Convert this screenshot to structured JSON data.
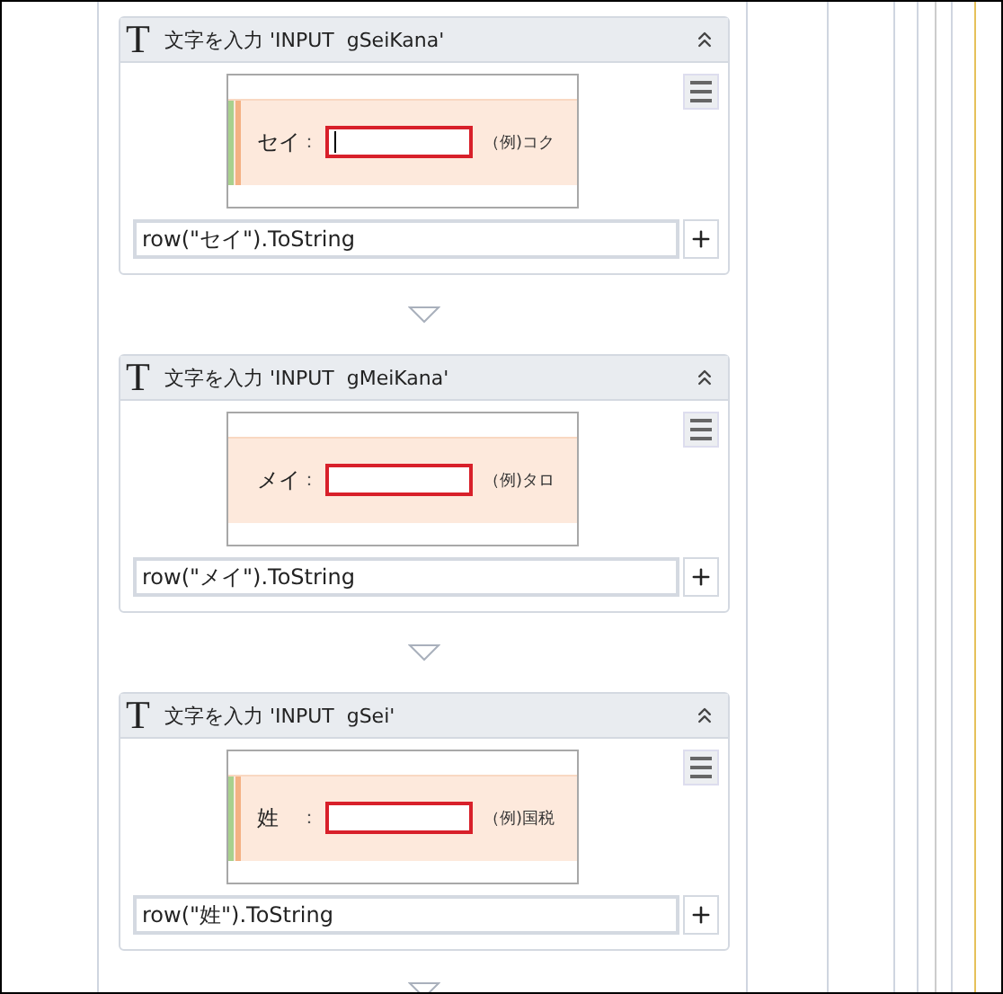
{
  "activities": [
    {
      "icon": "T",
      "title": "文字を入力 'INPUT  gSeiKana'",
      "expanded": true,
      "screenshot": {
        "label": "セイ",
        "colon": "：",
        "example": "（例)コク",
        "focused": true,
        "edge_marks": true
      },
      "expression": "row(\"セイ\").ToString"
    },
    {
      "icon": "T",
      "title": "文字を入力 'INPUT  gMeiKana'",
      "expanded": true,
      "screenshot": {
        "label": "メイ",
        "colon": "：",
        "example": "（例)タロ",
        "focused": false,
        "edge_marks": false
      },
      "expression": "row(\"メイ\").ToString"
    },
    {
      "icon": "T",
      "title": "文字を入力 'INPUT  gSei'",
      "expanded": true,
      "screenshot": {
        "label": "姓",
        "colon": "：",
        "example": "（例)国税",
        "focused": false,
        "edge_marks": true
      },
      "expression": "row(\"姓\").ToString"
    }
  ]
}
